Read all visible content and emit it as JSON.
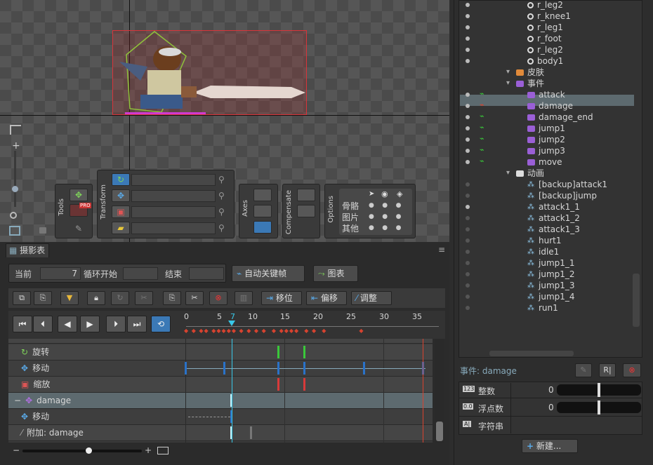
{
  "toolbar": {
    "tools_label": "Tools",
    "transform_label": "Transform",
    "axes_label": "Axes",
    "compensate_label": "Compensate",
    "options_label": "Options",
    "pro_badge": "PRO",
    "options_rows": [
      "骨骼",
      "图片",
      "其他"
    ]
  },
  "dopesheet": {
    "tab": "摄影表",
    "current_label": "当前",
    "current_value": "7",
    "loop_start_label": "循环开始",
    "end_label": "结束",
    "autokey_label": "自动关键帧",
    "graph_label": "图表",
    "move_btn": "移位",
    "offset_btn": "偏移",
    "adjust_btn": "调整",
    "ruler_ticks": [
      "0",
      "5",
      "7",
      "10",
      "15",
      "20",
      "25",
      "30",
      "35"
    ],
    "rows": [
      {
        "label": "旋转",
        "icon": "rotate-icon"
      },
      {
        "label": "移动",
        "icon": "move-icon"
      },
      {
        "label": "缩放",
        "icon": "scale-icon"
      },
      {
        "label": "damage",
        "icon": "event-icon"
      },
      {
        "label": "移动",
        "icon": "move-icon"
      },
      {
        "label": "附加: damage",
        "icon": "attachment-icon"
      }
    ]
  },
  "tree": {
    "items": [
      {
        "label": "r_leg2",
        "type": "bone"
      },
      {
        "label": "r_knee1",
        "type": "bone"
      },
      {
        "label": "r_leg1",
        "type": "bone"
      },
      {
        "label": "r_foot",
        "type": "bone"
      },
      {
        "label": "r_leg2",
        "type": "bone"
      },
      {
        "label": "body1",
        "type": "bone"
      },
      {
        "label": "皮肤",
        "type": "folder"
      },
      {
        "label": "事件",
        "type": "folder"
      },
      {
        "label": "attack",
        "type": "event"
      },
      {
        "label": "damage",
        "type": "event"
      },
      {
        "label": "damage_end",
        "type": "event"
      },
      {
        "label": "jump1",
        "type": "event"
      },
      {
        "label": "jump2",
        "type": "event"
      },
      {
        "label": "jump3",
        "type": "event"
      },
      {
        "label": "move",
        "type": "event"
      },
      {
        "label": "动画",
        "type": "folder"
      },
      {
        "label": "[backup]attack1",
        "type": "anim"
      },
      {
        "label": "[backup]jump",
        "type": "anim"
      },
      {
        "label": "attack1_1",
        "type": "anim"
      },
      {
        "label": "attack1_2",
        "type": "anim"
      },
      {
        "label": "attack1_3",
        "type": "anim"
      },
      {
        "label": "hurt1",
        "type": "anim"
      },
      {
        "label": "idle1",
        "type": "anim"
      },
      {
        "label": "jump1_1",
        "type": "anim"
      },
      {
        "label": "jump1_2",
        "type": "anim"
      },
      {
        "label": "jump1_3",
        "type": "anim"
      },
      {
        "label": "jump1_4",
        "type": "anim"
      },
      {
        "label": "run1",
        "type": "anim"
      }
    ]
  },
  "properties": {
    "title": "事件: damage",
    "int_label": "整数",
    "int_value": "0",
    "float_label": "浮点数",
    "float_value": "0",
    "string_label": "字符串",
    "new_button": "新建..."
  },
  "colors": {
    "accent": "#3b79b6",
    "key_red": "#d8432f",
    "playhead": "#38c8e8",
    "selected_row": "#5d6a6f"
  }
}
